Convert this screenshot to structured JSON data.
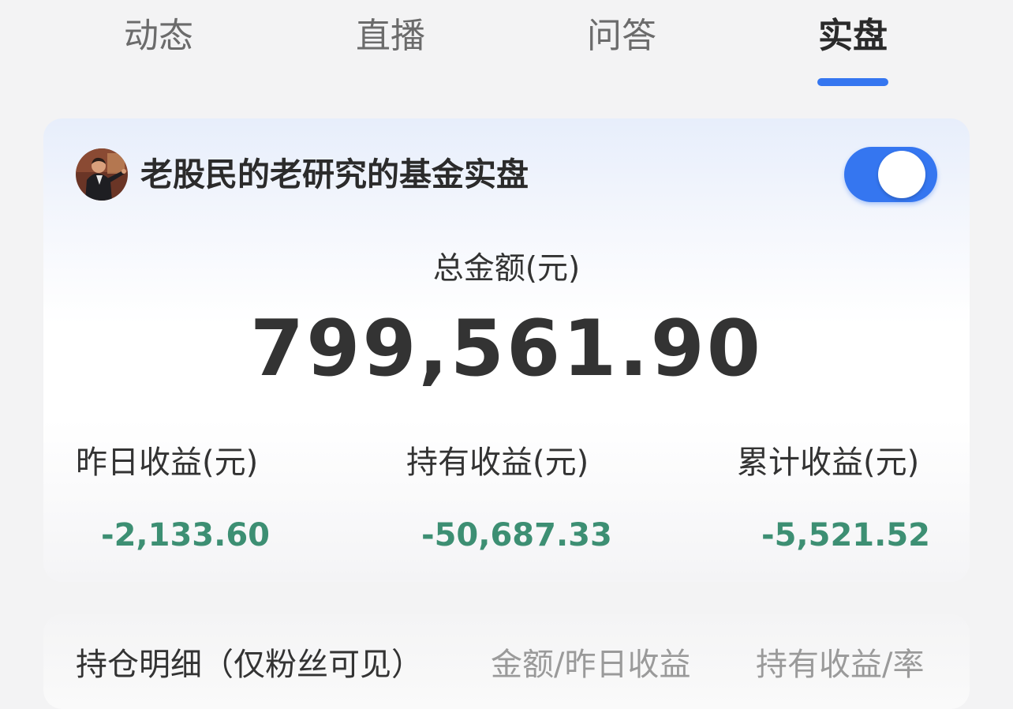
{
  "tabs": [
    {
      "label": "动态",
      "active": false
    },
    {
      "label": "直播",
      "active": false
    },
    {
      "label": "问答",
      "active": false
    },
    {
      "label": "实盘",
      "active": true
    }
  ],
  "portfolio": {
    "title": "老股民的老研究的基金实盘",
    "toggle_on": true,
    "total_label": "总金额(元)",
    "total_value": "799,561.90",
    "stats": [
      {
        "label": "昨日收益(元)",
        "value": "-2,133.60"
      },
      {
        "label": "持有收益(元)",
        "value": "-50,687.33"
      },
      {
        "label": "累计收益(元)",
        "value": "-5,521.52"
      }
    ]
  },
  "holdings": {
    "title": "持仓明细（仅粉丝可见）",
    "columns": [
      "金额/昨日收益",
      "持有收益/率"
    ]
  },
  "colors": {
    "accent": "#3576f0",
    "negative": "#3d8f73",
    "text": "#333333",
    "muted": "#9a9a9a"
  }
}
